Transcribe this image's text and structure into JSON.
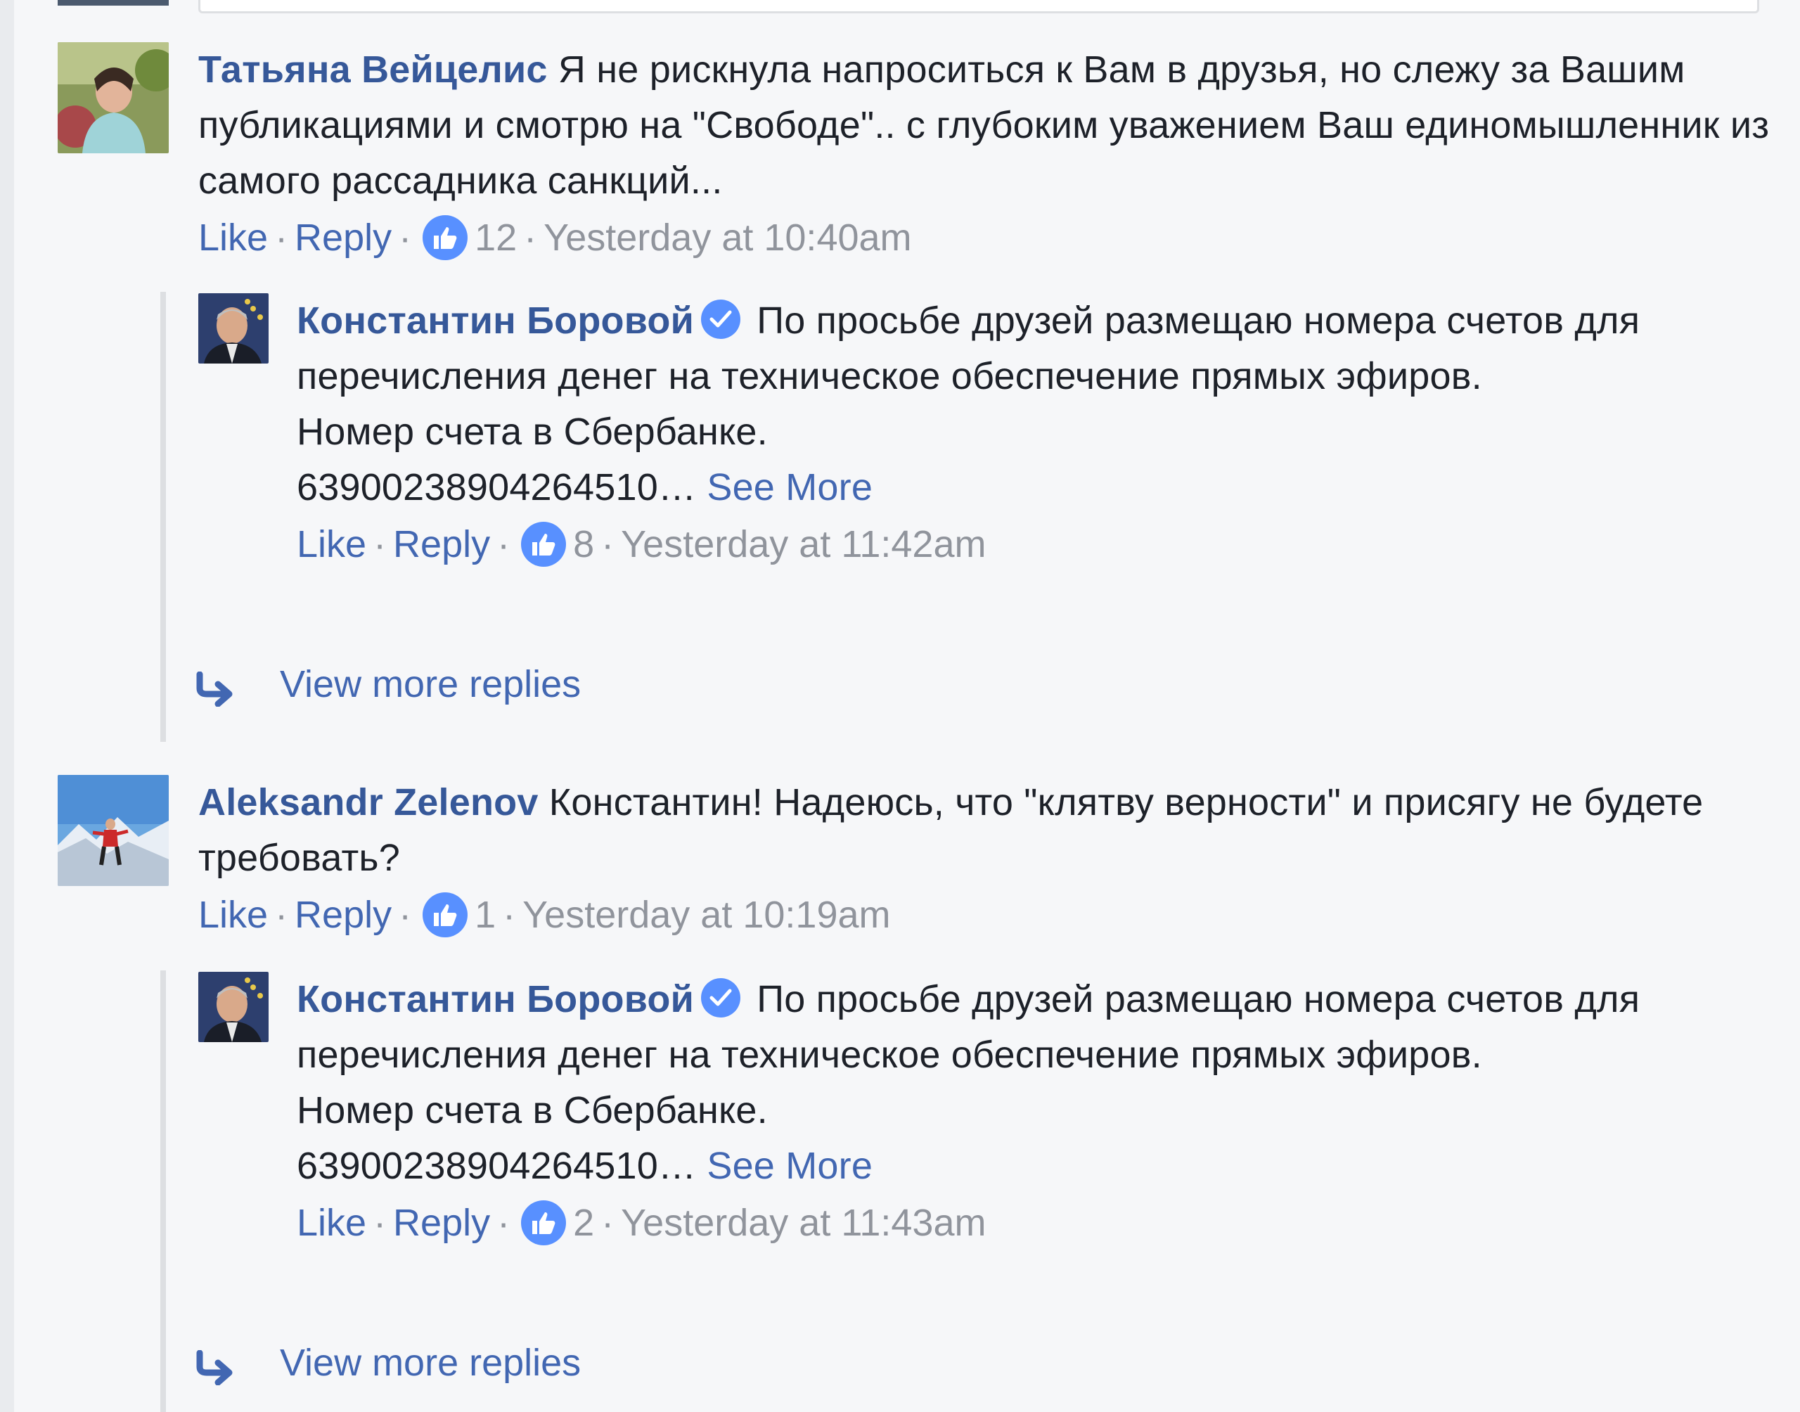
{
  "comments": [
    {
      "author": "Татьяна Вейцелис",
      "text": "Я не рискнула напроситься к Вам в друзья, но слежу за Вашим публикациями и смотрю на \"Свободе\".. с глубоким уважением Ваш единомышленник из самого рассадника санкций...",
      "like_label": "Like",
      "reply_label": "Reply",
      "like_count": "12",
      "timestamp": "Yesterday at 10:40am",
      "reply": {
        "author": "Константин Боровой",
        "line1": "По просьбе друзей размещаю номера счетов для перечисления денег на техническое обеспечение прямых эфиров.",
        "line2": "Номер счета в Сбербанке.",
        "line3": "63900238904264510…",
        "see_more": "See More",
        "like_label": "Like",
        "reply_label": "Reply",
        "like_count": "8",
        "timestamp": "Yesterday at 11:42am"
      },
      "view_more": "View more replies"
    },
    {
      "author": "Aleksandr Zelenov",
      "text": "Константин! Надеюсь, что \"клятву верности\" и присягу не будете требовать?",
      "like_label": "Like",
      "reply_label": "Reply",
      "like_count": "1",
      "timestamp": "Yesterday at 10:19am",
      "reply": {
        "author": "Константин Боровой",
        "line1": "По просьбе друзей размещаю номера счетов для перечисления денег на техническое обеспечение прямых эфиров.",
        "line2": "Номер счета в Сбербанке.",
        "line3": "63900238904264510…",
        "see_more": "See More",
        "like_label": "Like",
        "reply_label": "Reply",
        "like_count": "2",
        "timestamp": "Yesterday at 11:43am"
      },
      "view_more": "View more replies"
    }
  ],
  "colors": {
    "background": "#f6f7f9",
    "link": "#4267b2",
    "author": "#365899",
    "meta": "#90949c",
    "like_badge": "#5890ff"
  }
}
